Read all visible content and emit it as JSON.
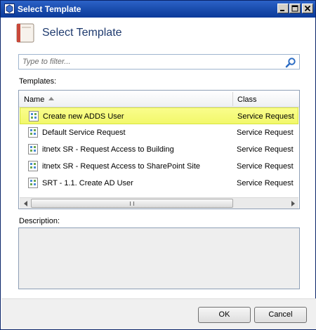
{
  "window": {
    "title": "Select Template"
  },
  "header": {
    "title": "Select Template"
  },
  "filter": {
    "placeholder": "Type to filter..."
  },
  "templates": {
    "label": "Templates:",
    "columns": {
      "name": "Name",
      "class": "Class"
    },
    "rows": [
      {
        "name": "Create new ADDS User",
        "class": "Service Request",
        "selected": true
      },
      {
        "name": "Default Service Request",
        "class": "Service Request",
        "selected": false
      },
      {
        "name": "itnetx SR - Request Access to Building",
        "class": "Service Request",
        "selected": false
      },
      {
        "name": "itnetx SR - Request Access to SharePoint Site",
        "class": "Service Request",
        "selected": false
      },
      {
        "name": "SRT - 1.1. Create AD User",
        "class": "Service Request",
        "selected": false
      }
    ]
  },
  "description": {
    "label": "Description:",
    "value": ""
  },
  "buttons": {
    "ok": "OK",
    "cancel": "Cancel"
  },
  "icons": {
    "window": "window-app-icon",
    "header": "template-document-icon",
    "search": "search-icon",
    "sort": "sort-ascending-icon",
    "row": "template-item-icon"
  }
}
